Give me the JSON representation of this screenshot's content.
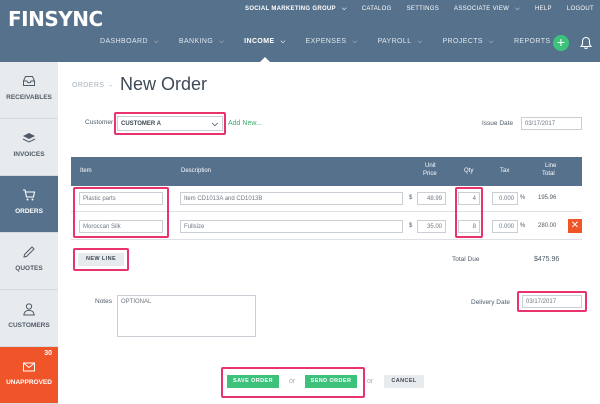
{
  "header": {
    "logo": "FINSYNC",
    "top_nav": [
      "SOCIAL MARKETING GROUP",
      "CATALOG",
      "SETTINGS",
      "ASSOCIATE VIEW",
      "HELP",
      "LOGOUT"
    ],
    "main_nav": [
      {
        "label": "DASHBOARD"
      },
      {
        "label": "BANKING"
      },
      {
        "label": "INCOME",
        "active": true
      },
      {
        "label": "EXPENSES"
      },
      {
        "label": "PAYROLL"
      },
      {
        "label": "PROJECTS"
      },
      {
        "label": "REPORTS"
      }
    ],
    "add_symbol": "+"
  },
  "sidebar": {
    "items": [
      {
        "label": "RECEIVABLES",
        "icon": "inbox-icon"
      },
      {
        "label": "INVOICES",
        "icon": "layers-icon"
      },
      {
        "label": "ORDERS",
        "icon": "cart-icon"
      },
      {
        "label": "QUOTES",
        "icon": "pencil-icon"
      },
      {
        "label": "CUSTOMERS",
        "icon": "user-icon"
      },
      {
        "label": "UNAPPROVED",
        "icon": "mail-icon",
        "badge": "30"
      }
    ]
  },
  "page": {
    "breadcrumb": "ORDERS →",
    "title": "New Order",
    "customer_label": "Customer",
    "customer_value": "CUSTOMER A",
    "add_new": "Add New...",
    "issue_date_label": "Issue Date",
    "issue_date": "03/17/2017"
  },
  "table": {
    "headers": {
      "item": "Item",
      "description": "Description",
      "unit_price_1": "Unit",
      "unit_price_2": "Price",
      "qty": "Qty",
      "tax": "Tax",
      "line_total_1": "Line",
      "line_total_2": "Total"
    },
    "rows": [
      {
        "item": "Plastic parts",
        "description": "Item CD1013A and CD1013B",
        "currency": "$",
        "unit_price": "48.99",
        "qty": "4",
        "tax": "0.000",
        "pct": "%",
        "line_total": "195.96"
      },
      {
        "item": "Moroccan Silk",
        "description": "Fullsize",
        "currency": "$",
        "unit_price": "35.00",
        "qty": "8",
        "tax": "0.000",
        "pct": "%",
        "line_total": "280.00"
      }
    ],
    "delete_symbol": "✕"
  },
  "new_line": "NEW LINE",
  "total_due_label": "Total Due",
  "total_due": "$475.96",
  "notes_label": "Notes",
  "notes_placeholder": "OPTIONAL",
  "delivery_date_label": "Delivery Date",
  "delivery_date": "03/17/2017",
  "actions": {
    "save": "SAVE ORDER",
    "or1": "or",
    "send": "SEND ORDER",
    "or2": "or",
    "cancel": "CANCEL"
  },
  "colors": {
    "header": "#56718c",
    "accent_green": "#3dc27b",
    "highlight": "#e8336d",
    "unapproved": "#f0552a"
  }
}
